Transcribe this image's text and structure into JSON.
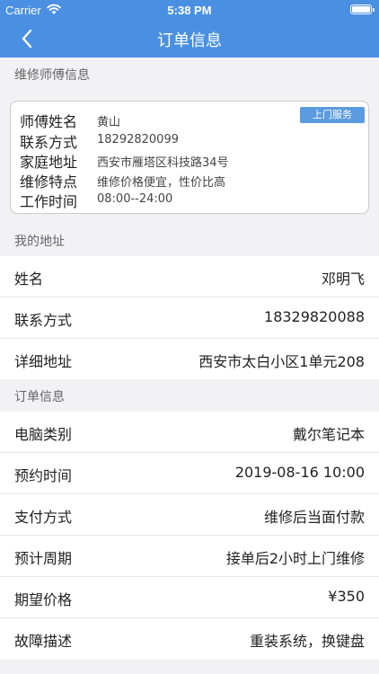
{
  "status_bar": {
    "carrier": "Carrier",
    "time": "5:38 PM"
  },
  "nav": {
    "title": "订单信息",
    "back_icon": "chevron-left-icon"
  },
  "repairman": {
    "section_title": "维修师傅信息",
    "badge": "上门服务",
    "rows": [
      {
        "label": "师傅姓名",
        "value": "黄山"
      },
      {
        "label": "联系方式",
        "value": "18292820099"
      },
      {
        "label": "家庭地址",
        "value": "西安市雁塔区科技路34号"
      },
      {
        "label": "维修特点",
        "value": "维修价格便宜，性价比高"
      },
      {
        "label": "工作时间",
        "value": "08:00--24:00"
      }
    ]
  },
  "address": {
    "section_title": "我的地址",
    "rows": [
      {
        "label": "姓名",
        "value": "邓明飞"
      },
      {
        "label": "联系方式",
        "value": "18329820088"
      },
      {
        "label": "详细地址",
        "value": "西安市太白小区1单元208"
      }
    ]
  },
  "order": {
    "section_title": "订单信息",
    "rows": [
      {
        "label": "电脑类别",
        "value": "戴尔笔记本"
      },
      {
        "label": "预约时间",
        "value": "2019-08-16 10:00"
      },
      {
        "label": "支付方式",
        "value": "维修后当面付款"
      },
      {
        "label": "预计周期",
        "value": "接单后2小时上门维修"
      },
      {
        "label": "期望价格",
        "value": "¥350"
      },
      {
        "label": "故障描述",
        "value": "重装系统，换键盘"
      }
    ]
  },
  "colors": {
    "accent": "#4a90e2",
    "badge": "#5b9bdf",
    "background": "#f2f2f4"
  }
}
